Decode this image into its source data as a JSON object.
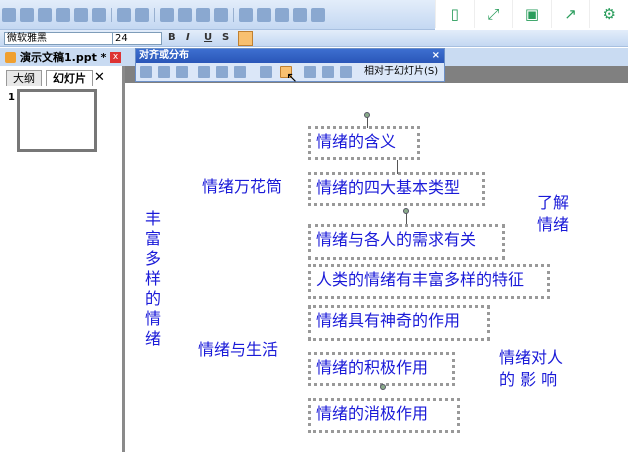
{
  "toolbar": {
    "font_name": "微软雅黑",
    "font_size": "24",
    "bold": "B",
    "italic": "I",
    "underline": "U",
    "shadow": "S"
  },
  "right_panel": {
    "icons": [
      "tablet-icon",
      "fullscreen-icon",
      "save-icon",
      "share-icon",
      "settings-icon"
    ],
    "glyphs": [
      "▯",
      "⤢",
      "▣",
      "↗",
      "⚙"
    ]
  },
  "document_tab": {
    "title": "演示文稿1.ppt *"
  },
  "left_pane": {
    "tabs": [
      "大纲",
      "幻灯片"
    ],
    "close": "✕",
    "slide_number": "1"
  },
  "align_panel": {
    "title": "对齐或分布",
    "close": "×",
    "relative_button": "相对于幻灯片(S)"
  },
  "slide": {
    "boxes": [
      "情绪的含义",
      "情绪的四大基本类型",
      "情绪与各人的需求有关",
      "人类的情绪有丰富多样的特征",
      "情绪具有神奇的作用",
      "情绪的积极作用",
      "情绪的消极作用"
    ],
    "labels": {
      "kaleidoscope": "情绪万花筒",
      "understand": "了解\n情绪",
      "rich": "丰富多样的情绪",
      "life": "情绪与生活",
      "impact": "情绪对人\n的 影 响"
    }
  },
  "colors": {
    "text": "#1a1ad8",
    "accent": "#2a9d5c"
  }
}
